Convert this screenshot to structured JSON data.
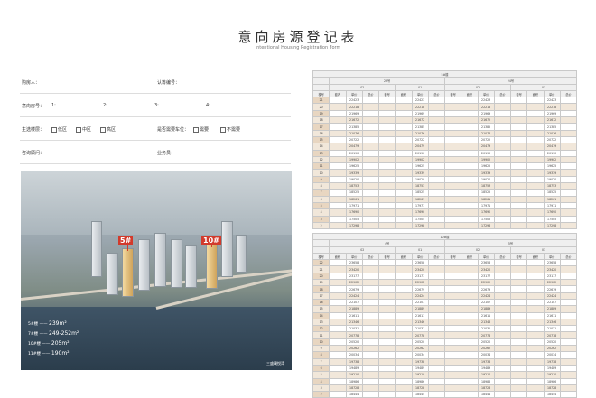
{
  "title": "意向房源登记表",
  "subtitle": "Intentional Housing Registration Form",
  "form": {
    "buyer": "购房人：",
    "cert_no": "认筹编号：",
    "rank": "意向房号：",
    "nums": [
      "1:",
      "2:",
      "3:",
      "4:"
    ],
    "area_q": "主选楼层：",
    "area_opts": [
      "低区",
      "中区",
      "高区"
    ],
    "parking_q": "是否需要车位：",
    "parking_opts": [
      "需要",
      "不需要"
    ],
    "advisor": "咨询顾问：",
    "staff": "业务员："
  },
  "render": {
    "tag_a": "5#",
    "tag_b": "10#",
    "legend": [
      {
        "label": "5#楼",
        "value": "239m²"
      },
      {
        "label": "7#楼",
        "value": "249-252m²"
      },
      {
        "label": "10#楼",
        "value": "205m²"
      },
      {
        "label": "11#楼",
        "value": "190m²"
      }
    ],
    "logo": "三盛璞悦湾"
  },
  "table1": {
    "building": "5#楼",
    "units": [
      "23号",
      "24号"
    ],
    "sub": [
      "02",
      "01",
      "02",
      "01"
    ],
    "cols": [
      "楼号",
      "套内",
      "单价",
      "总价",
      "套号",
      "面积",
      "单价",
      "总价",
      "套号",
      "面积",
      "单价",
      "总价",
      "套号",
      "面积",
      "单价",
      "总价"
    ],
    "floors": [
      21,
      20,
      19,
      18,
      17,
      16,
      15,
      14,
      13,
      12,
      11,
      10,
      9,
      8,
      7,
      6,
      5,
      4,
      3,
      2
    ],
    "prices": [
      "22423",
      "22218",
      "21969",
      "21672",
      "21385",
      "21076",
      "20722",
      "20479",
      "20190",
      "19902",
      "19625",
      "19339",
      "19020",
      "18753",
      "18525",
      "18261",
      "17971",
      "17690",
      "17505",
      "17298"
    ]
  },
  "table2": {
    "building": "10#楼",
    "units": [
      "4号",
      "5号"
    ],
    "sub": [
      "02",
      "01",
      "02",
      "01"
    ],
    "cols": [
      "楼号",
      "面积",
      "单价",
      "总价",
      "套号",
      "面积",
      "单价",
      "总价",
      "套号",
      "面积",
      "单价",
      "总价",
      "套号",
      "面积",
      "单价",
      "总价"
    ],
    "floors": [
      22,
      21,
      20,
      19,
      18,
      17,
      16,
      15,
      14,
      13,
      12,
      11,
      10,
      9,
      8,
      7,
      6,
      5,
      4,
      3,
      2
    ],
    "prices": [
      "23658",
      "23420",
      "23177",
      "22902",
      "22679",
      "22424",
      "22107",
      "21889",
      "21611",
      "21346",
      "21031",
      "20778",
      "20520",
      "20262",
      "20034",
      "19738",
      "19489",
      "19210",
      "18986",
      "18728",
      "18444"
    ]
  }
}
